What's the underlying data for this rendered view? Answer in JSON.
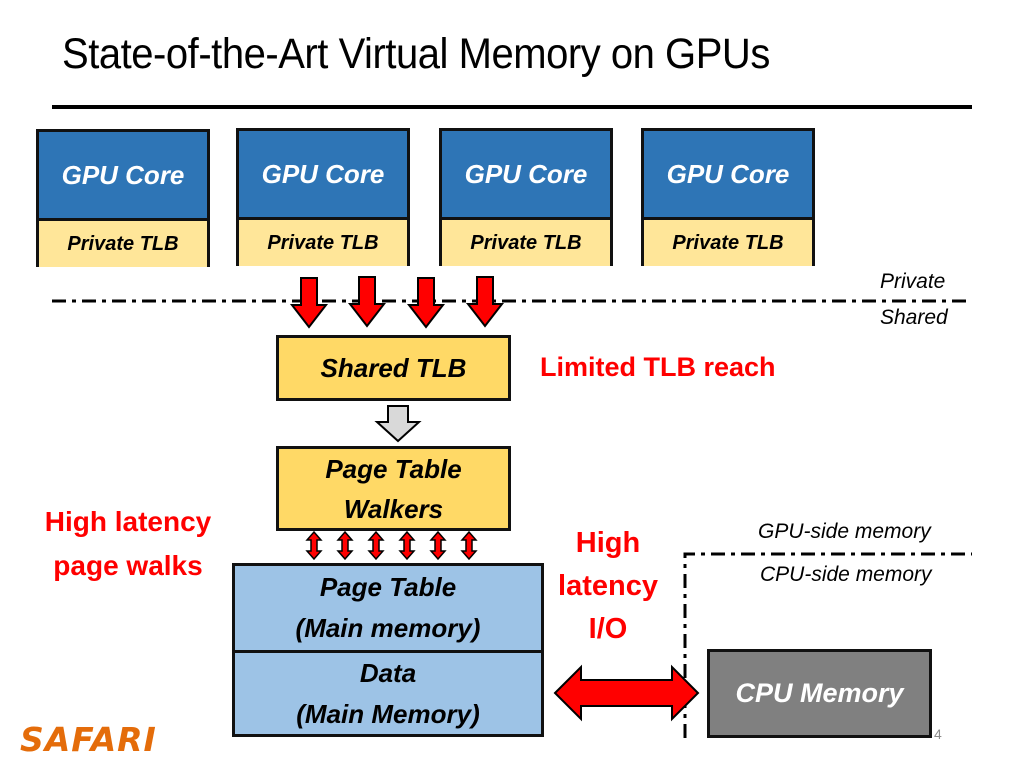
{
  "slide": {
    "title": "State-of-the-Art Virtual Memory on GPUs",
    "page_number": "4",
    "logo": "SAFARI"
  },
  "gpu_cores": [
    {
      "core_label": "GPU Core",
      "tlb_label": "Private TLB"
    },
    {
      "core_label": "GPU Core",
      "tlb_label": "Private TLB"
    },
    {
      "core_label": "GPU Core",
      "tlb_label": "Private TLB"
    },
    {
      "core_label": "GPU Core",
      "tlb_label": "Private TLB"
    }
  ],
  "boundaries": {
    "private": "Private",
    "shared": "Shared",
    "gpu_side": "GPU-side memory",
    "cpu_side": "CPU-side memory"
  },
  "blocks": {
    "shared_tlb": "Shared TLB",
    "ptw_line1": "Page Table",
    "ptw_line2": "Walkers",
    "pt_line1": "Page Table",
    "pt_line2": "(Main memory)",
    "data_line1": "Data",
    "data_line2": "(Main Memory)",
    "cpu_memory": "CPU Memory"
  },
  "annotations": {
    "tlb_reach": "Limited TLB reach",
    "walks_line1": "High latency",
    "walks_line2": "page walks",
    "io_line1": "High",
    "io_line2": "latency",
    "io_line3": "I/O"
  },
  "colors": {
    "gpu_core": "#2e75b6",
    "tlb": "#ffe699",
    "shared_tlb": "#ffd966",
    "main_memory": "#9dc3e6",
    "cpu_memory": "#808080",
    "highlight": "#ff0000",
    "logo": "#e46c0a"
  }
}
